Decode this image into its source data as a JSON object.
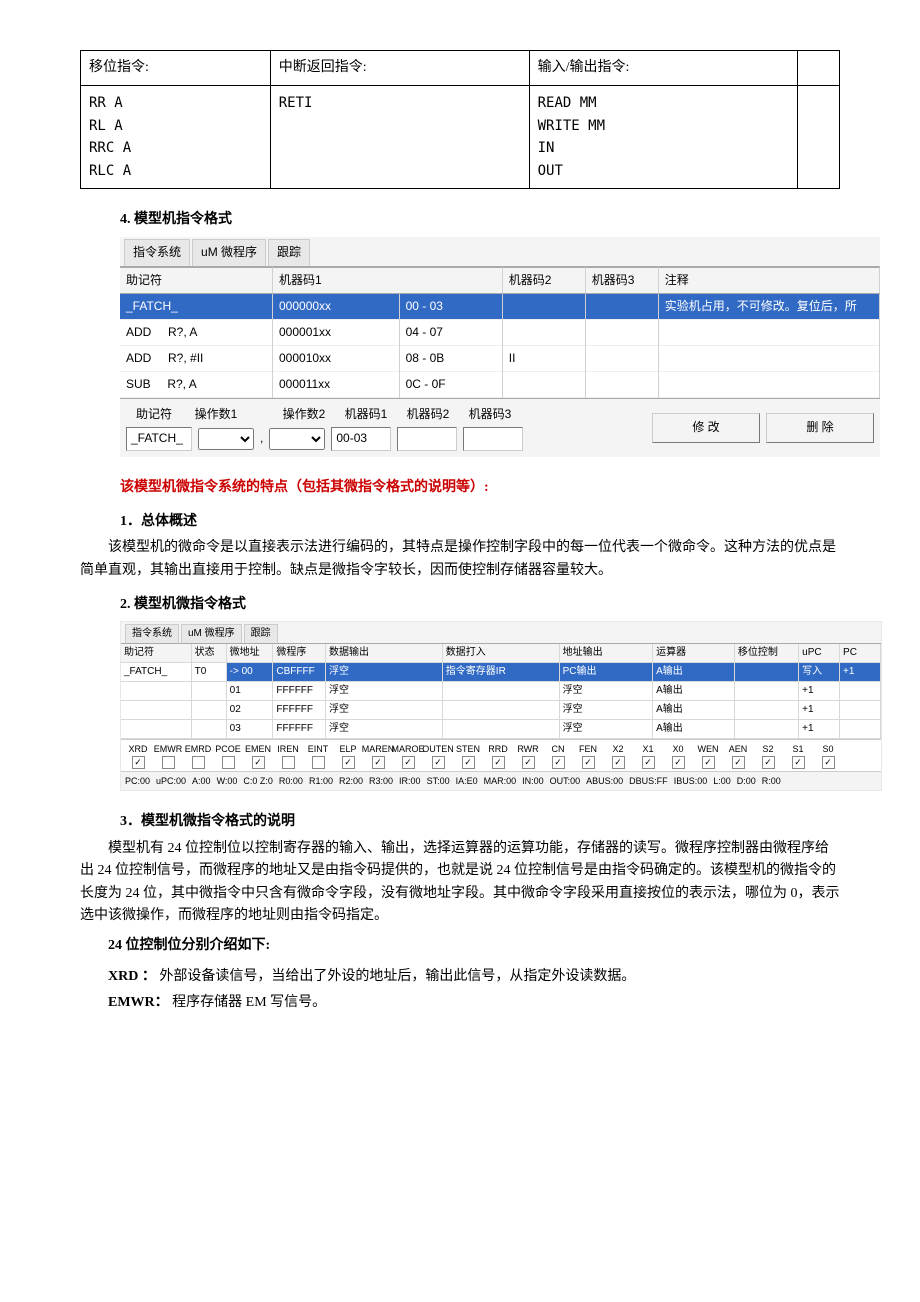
{
  "top_table": {
    "headers": [
      "移位指令:",
      "中断返回指令:",
      "输入/输出指令:",
      ""
    ],
    "cells": [
      "RR A\nRL A\nRRC A\nRLC A",
      "RETI",
      "READ MM\nWRITE MM\nIN\nOUT",
      ""
    ]
  },
  "section4_title": "4. 模型机指令格式",
  "scr1": {
    "tabs": [
      "指令系统",
      "uM 微程序",
      "跟踪"
    ],
    "cols": [
      "助记符",
      "机器码1",
      "机器码2",
      "机器码3",
      "注释"
    ],
    "rows": [
      {
        "m": "_FATCH_",
        "c1a": "000000xx",
        "c1b": "00 - 03",
        "c2": "",
        "c3": "",
        "note": "实验机占用，不可修改。复位后，所",
        "sel": true
      },
      {
        "m": "ADD     R?, A",
        "c1a": "000001xx",
        "c1b": "04 - 07",
        "c2": "",
        "c3": "",
        "note": ""
      },
      {
        "m": "ADD     R?, #II",
        "c1a": "000010xx",
        "c1b": "08 - 0B",
        "c2": "II",
        "c3": "",
        "note": ""
      },
      {
        "m": "SUB     R?, A",
        "c1a": "000011xx",
        "c1b": "0C - 0F",
        "c2": "",
        "c3": "",
        "note": ""
      }
    ],
    "form_labels": [
      "助记符",
      "操作数1",
      "操作数2",
      "机器码1",
      "机器码2",
      "机器码3"
    ],
    "form_mnemonic": "_FATCH_",
    "form_code1": "00-03",
    "btn_modify": "修 改",
    "btn_delete": "删 除",
    "comma": ","
  },
  "red_text": "该模型机微指令系统的特点（包括其微指令格式的说明等）:",
  "sec1_title": "1．总体概述",
  "sec1_body": "该模型机的微命令是以直接表示法进行编码的，其特点是操作控制字段中的每一位代表一个微命令。这种方法的优点是简单直观，其输出直接用于控制。缺点是微指令字较长，因而使控制存储器容量较大。",
  "sec2_title": "2. 模型机微指令格式",
  "scr2": {
    "tabs": [
      "指令系统",
      "uM 微程序",
      "跟踪"
    ],
    "cols": [
      "助记符",
      "状态",
      "微地址",
      "微程序",
      "数据输出",
      "数据打入",
      "地址输出",
      "运算器",
      "移位控制",
      "uPC",
      "PC"
    ],
    "rows": [
      {
        "m": "_FATCH_",
        "st": "T0",
        "ua": "-> 00",
        "up": "CBFFFF",
        "do": "浮空",
        "di": "指令寄存器IR",
        "ao": "PC输出",
        "alu": "A输出",
        "sh": "",
        "upc": "写入",
        "pc": "+1",
        "sel": true
      },
      {
        "m": "",
        "st": "",
        "ua": "01",
        "up": "FFFFFF",
        "do": "浮空",
        "di": "",
        "ao": "浮空",
        "alu": "A输出",
        "sh": "",
        "upc": "+1",
        "pc": ""
      },
      {
        "m": "",
        "st": "",
        "ua": "02",
        "up": "FFFFFF",
        "do": "浮空",
        "di": "",
        "ao": "浮空",
        "alu": "A输出",
        "sh": "",
        "upc": "+1",
        "pc": ""
      },
      {
        "m": "",
        "st": "",
        "ua": "03",
        "up": "FFFFFF",
        "do": "浮空",
        "di": "",
        "ao": "浮空",
        "alu": "A输出",
        "sh": "",
        "upc": "+1",
        "pc": ""
      }
    ],
    "flags": [
      {
        "n": "XRD",
        "c": true
      },
      {
        "n": "EMWR",
        "c": false
      },
      {
        "n": "EMRD",
        "c": false
      },
      {
        "n": "PCOE",
        "c": false
      },
      {
        "n": "EMEN",
        "c": true
      },
      {
        "n": "IREN",
        "c": false
      },
      {
        "n": "EINT",
        "c": false
      },
      {
        "n": "ELP",
        "c": true
      },
      {
        "n": "MAREN",
        "c": true
      },
      {
        "n": "MAROE",
        "c": true
      },
      {
        "n": "OUTEN",
        "c": true
      },
      {
        "n": "STEN",
        "c": true
      },
      {
        "n": "RRD",
        "c": true
      },
      {
        "n": "RWR",
        "c": true
      },
      {
        "n": "CN",
        "c": true
      },
      {
        "n": "FEN",
        "c": true
      },
      {
        "n": "X2",
        "c": true
      },
      {
        "n": "X1",
        "c": true
      },
      {
        "n": "X0",
        "c": true
      },
      {
        "n": "WEN",
        "c": true
      },
      {
        "n": "AEN",
        "c": true
      },
      {
        "n": "S2",
        "c": true
      },
      {
        "n": "S1",
        "c": true
      },
      {
        "n": "S0",
        "c": true
      }
    ],
    "status": [
      "PC:00",
      "uPC:00",
      "A:00",
      "W:00",
      "C:0 Z:0",
      "R0:00",
      "R1:00",
      "R2:00",
      "R3:00",
      "IR:00",
      "ST:00",
      "IA:E0",
      "MAR:00",
      "IN:00",
      "OUT:00",
      "ABUS:00",
      "DBUS:FF",
      "IBUS:00",
      "L:00",
      "D:00",
      "R:00"
    ]
  },
  "sec3_title": "3．模型机微指令格式的说明",
  "sec3_body": "模型机有 24 位控制位以控制寄存器的输入、输出，选择运算器的运算功能，存储器的读写。微程序控制器由微程序给出 24 位控制信号，而微程序的地址又是由指令码提供的，也就是说 24 位控制信号是由指令码确定的。该模型机的微指令的长度为 24 位，其中微指令中只含有微命令字段，没有微地址字段。其中微命令字段采用直接按位的表示法，哪位为 0，表示选中该微操作，而微程序的地址则由指令码指定。",
  "sec3_line2": "24 位控制位分别介绍如下:",
  "sig_xrd": "XRD ：   外部设备读信号，当给出了外设的地址后，输出此信号，从指定外设读数据。",
  "sig_emwr": "EMWR：  程序存储器 EM 写信号。"
}
